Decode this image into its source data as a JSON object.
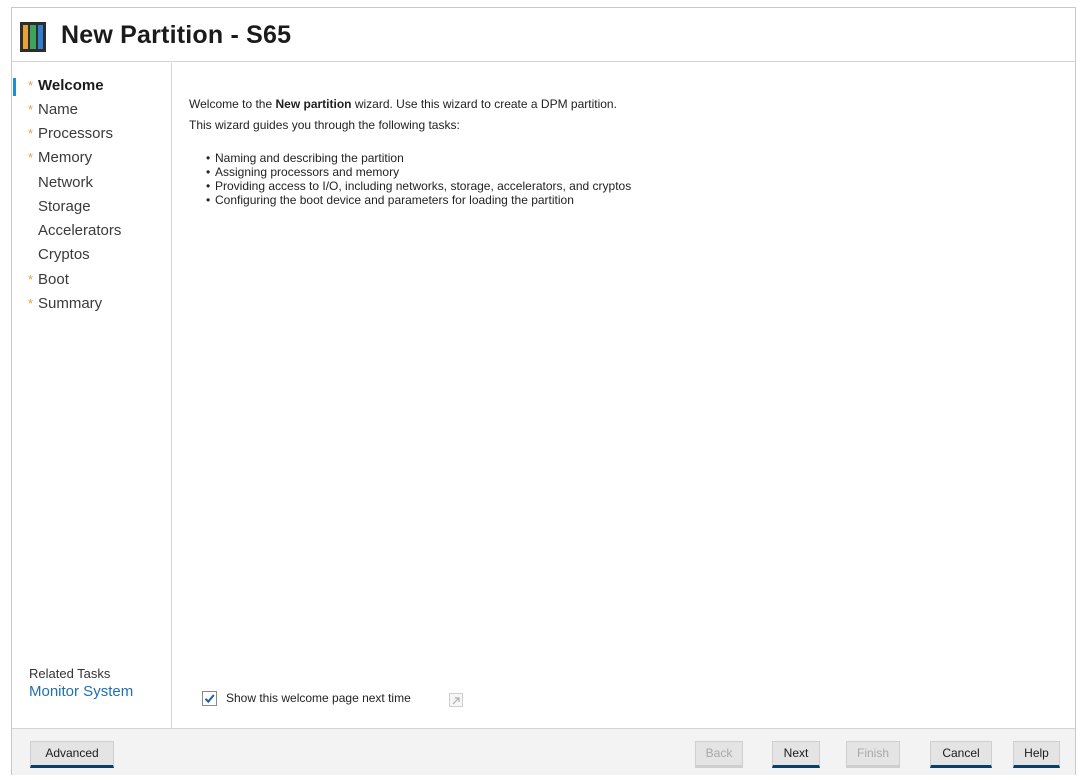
{
  "window": {
    "title": "New Partition - S65"
  },
  "sidebar": {
    "items": [
      {
        "label": "Welcome",
        "required": true,
        "active": true
      },
      {
        "label": "Name",
        "required": true,
        "active": false
      },
      {
        "label": "Processors",
        "required": true,
        "active": false
      },
      {
        "label": "Memory",
        "required": true,
        "active": false
      },
      {
        "label": "Network",
        "required": false,
        "active": false
      },
      {
        "label": "Storage",
        "required": false,
        "active": false
      },
      {
        "label": "Accelerators",
        "required": false,
        "active": false
      },
      {
        "label": "Cryptos",
        "required": false,
        "active": false
      },
      {
        "label": "Boot",
        "required": true,
        "active": false
      },
      {
        "label": "Summary",
        "required": true,
        "active": false
      }
    ],
    "required_marker": "*",
    "related_tasks_title": "Related Tasks",
    "related_tasks_link": "Monitor System"
  },
  "content": {
    "intro_prefix": "Welcome to the ",
    "intro_bold": "New partition",
    "intro_suffix": " wizard. Use this wizard to create a DPM partition.",
    "intro2": "This wizard guides you through the following tasks:",
    "tasks": [
      "Naming and describing the partition",
      "Assigning processors and memory",
      "Providing access to I/O, including networks, storage, accelerators, and cryptos",
      "Configuring the boot device and parameters for loading the partition"
    ],
    "bullet": "•",
    "show_welcome_label": "Show this welcome page next time",
    "show_welcome_checked": true
  },
  "footer": {
    "advanced": "Advanced",
    "back": "Back",
    "next": "Next",
    "finish": "Finish",
    "cancel": "Cancel",
    "help": "Help"
  },
  "colors": {
    "accent": "#1e8dd6",
    "required_star": "#e8a23a",
    "link": "#1f6fb2",
    "button_underline": "#0c3f66"
  },
  "icons": {
    "app": "partition-app-icon",
    "checkbox": "check-icon",
    "help": "help-popout-icon"
  }
}
